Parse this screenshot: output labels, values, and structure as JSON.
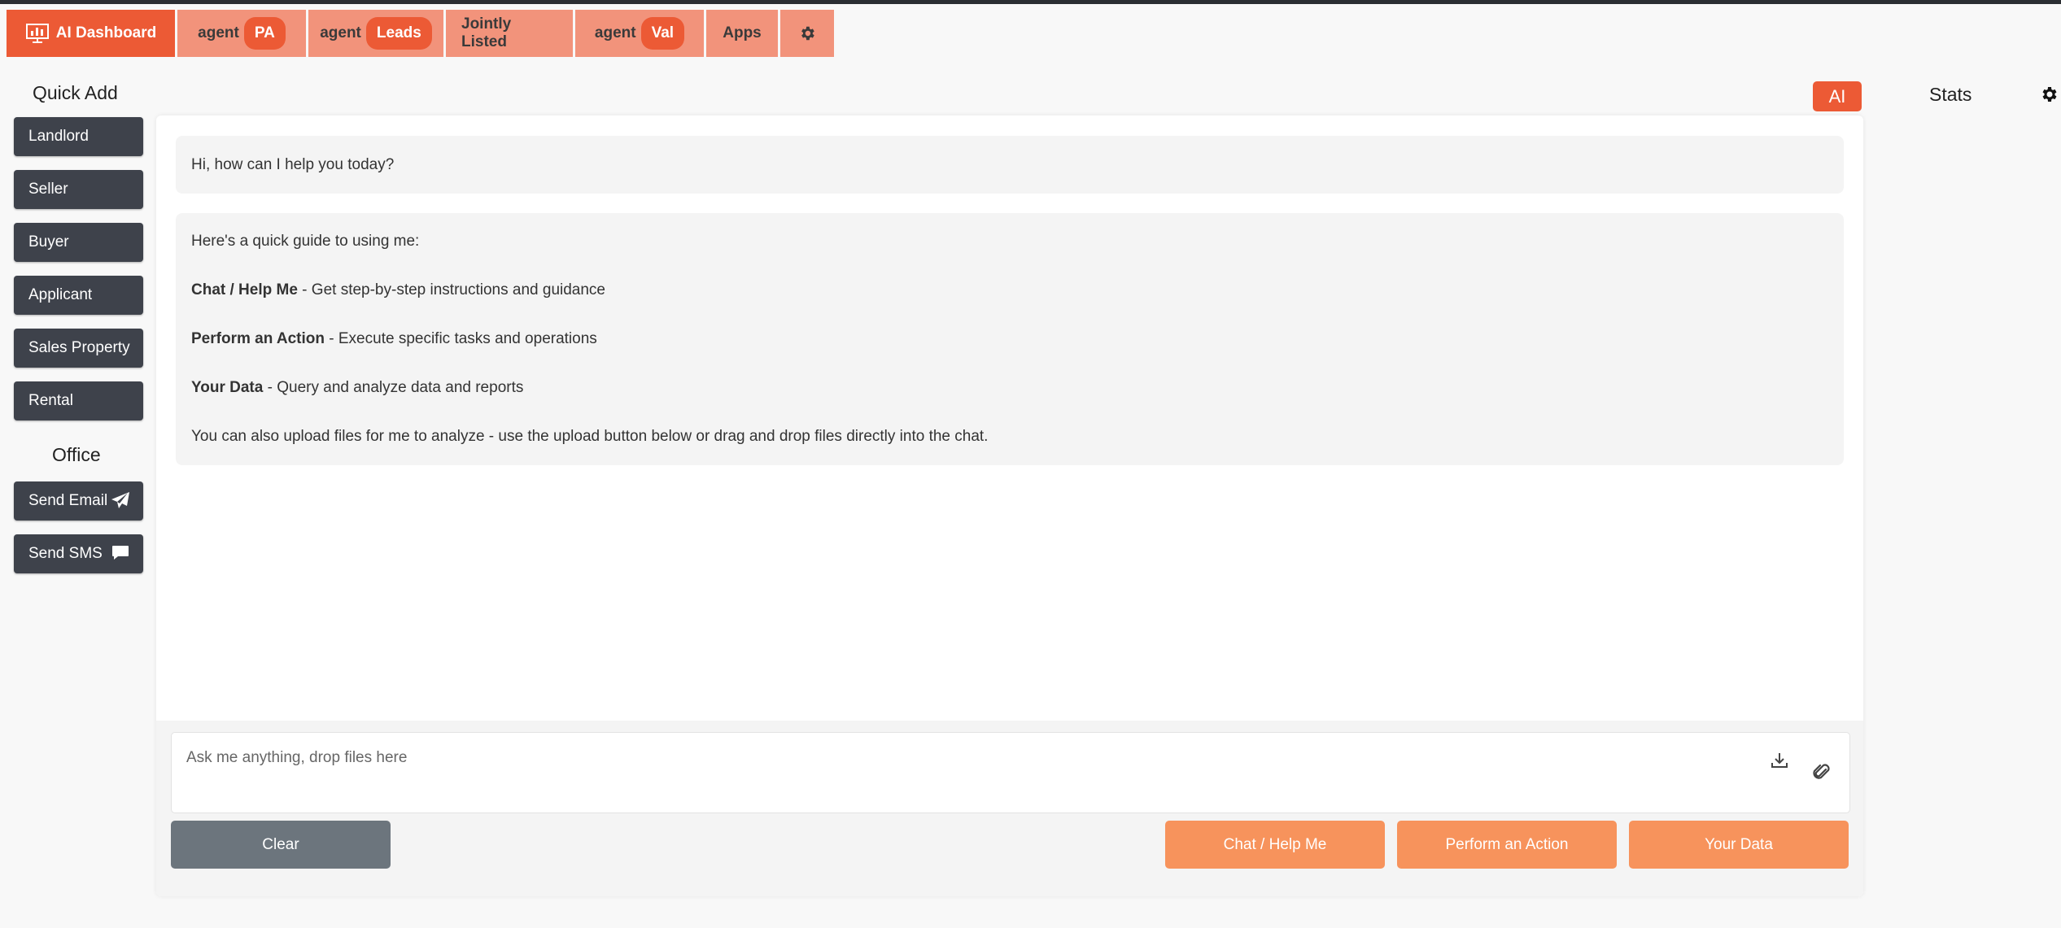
{
  "tabs": [
    {
      "label": "AI Dashboard",
      "active": true
    },
    {
      "prefix": "agent",
      "pill": "PA"
    },
    {
      "prefix": "agent",
      "pill": "Leads"
    },
    {
      "label": "Jointly Listed"
    },
    {
      "prefix": "agent",
      "pill": "Val"
    },
    {
      "label": "Apps"
    }
  ],
  "sidebar": {
    "quick_add_title": "Quick Add",
    "quick_add_items": [
      "Landlord",
      "Seller",
      "Buyer",
      "Applicant",
      "Sales Property",
      "Rental"
    ],
    "office_title": "Office",
    "office_items": [
      "Send Email",
      "Send SMS"
    ]
  },
  "header": {
    "ai_badge": "AI",
    "stats_label": "Stats"
  },
  "chat": {
    "greeting": "Hi, how can I help you today?",
    "guide_intro": "Here's a quick guide to using me:",
    "guide_items": [
      {
        "title": "Chat / Help Me",
        "desc": " - Get step-by-step instructions and guidance"
      },
      {
        "title": "Perform an Action",
        "desc": " - Execute specific tasks and operations"
      },
      {
        "title": "Your Data",
        "desc": " - Query and analyze data and reports"
      }
    ],
    "guide_footer": "You can also upload files for me to analyze - use the upload button below or drag and drop files directly into the chat.",
    "input_placeholder": "Ask me anything, drop files here"
  },
  "actions": {
    "clear": "Clear",
    "chat_help": "Chat / Help Me",
    "perform_action": "Perform an Action",
    "your_data": "Your Data"
  },
  "colors": {
    "accent": "#ec5a35",
    "tab": "#f2937b",
    "sidebar_button": "#3e424b",
    "action_button": "#f7935c",
    "clear_button": "#6c757d"
  },
  "icons": {
    "dashboard": "dashboard-icon",
    "settings": "gear-icon",
    "email": "paper-plane-icon",
    "sms": "chat-bubble-icon",
    "download": "download-icon",
    "attach": "paperclip-icon"
  }
}
